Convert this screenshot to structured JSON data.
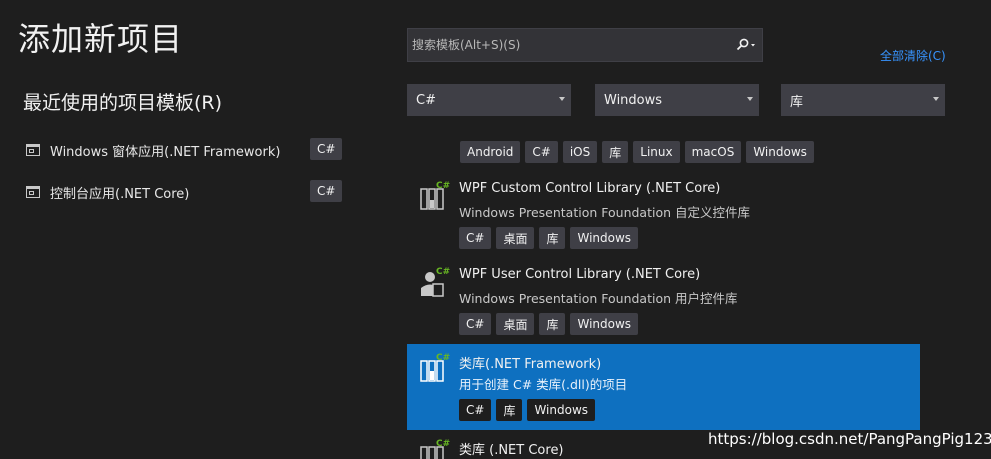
{
  "page_title": "添加新项目",
  "recent": {
    "title": "最近使用的项目模板(R)",
    "items": [
      {
        "label": "Windows 窗体应用(.NET Framework)",
        "tag": "C#"
      },
      {
        "label": "控制台应用(.NET Core)",
        "tag": "C#"
      }
    ]
  },
  "search": {
    "placeholder": "搜索模板(Alt+S)(S)"
  },
  "clear_all": "全部清除(C)",
  "filters": {
    "language": "C#",
    "platform": "Windows",
    "project_type": "库"
  },
  "filter_tags": [
    "Android",
    "C#",
    "iOS",
    "库",
    "Linux",
    "macOS",
    "Windows"
  ],
  "templates": [
    {
      "name": "WPF Custom Control Library (.NET Core)",
      "description": "Windows Presentation Foundation 自定义控件库",
      "tags": [
        "C#",
        "桌面",
        "库",
        "Windows"
      ],
      "icon": "wpf-custom-control-library-icon"
    },
    {
      "name": "WPF User Control Library (.NET Core)",
      "description": "Windows Presentation Foundation 用户控件库",
      "tags": [
        "C#",
        "桌面",
        "库",
        "Windows"
      ],
      "icon": "wpf-user-control-library-icon"
    },
    {
      "name": "类库(.NET Framework)",
      "description": "用于创建 C# 类库(.dll)的项目",
      "tags": [
        "C#",
        "库",
        "Windows"
      ],
      "icon": "class-library-icon",
      "selected": true
    },
    {
      "name": "类库 (.NET Core)",
      "description": "",
      "tags": [],
      "icon": "class-library-icon"
    }
  ],
  "watermark": "https://blog.csdn.net/PangPangPig123",
  "colors": {
    "background": "#1e1e1e",
    "selection": "#0e70c0",
    "link": "#3794ff",
    "tag_bg": "#3f3f46",
    "csharp_badge": "#68b723"
  }
}
